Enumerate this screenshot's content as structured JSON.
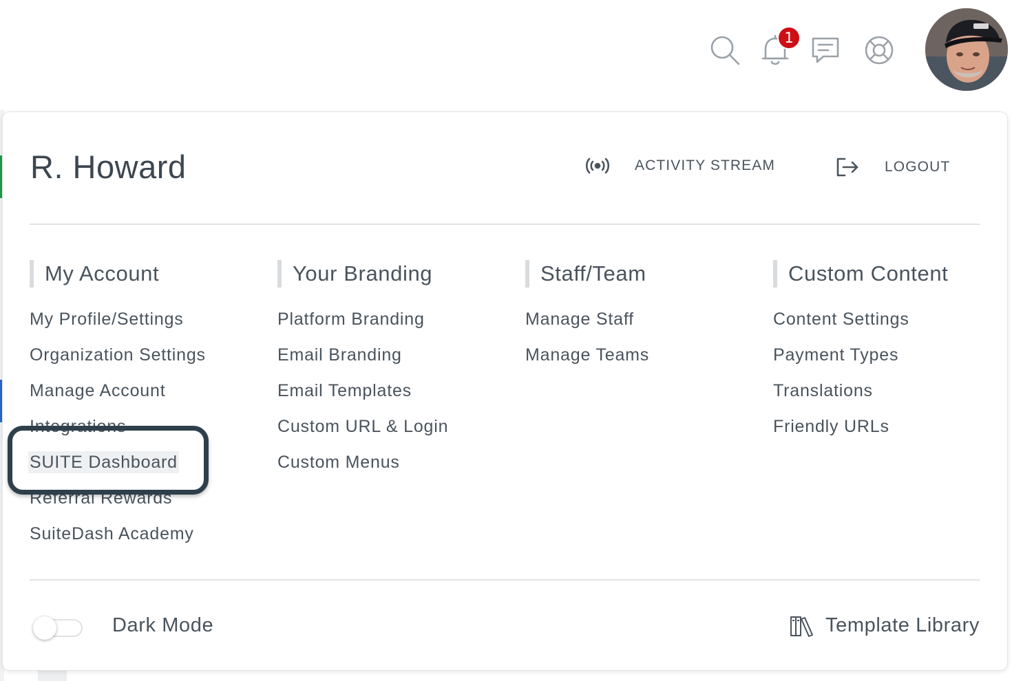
{
  "topbar": {
    "icons": [
      "search-icon",
      "bell-icon",
      "chat-icon",
      "support-icon"
    ],
    "notification_count": "1",
    "badge_color": "#cc1016"
  },
  "panel": {
    "user_name": "R. Howard",
    "activity_stream_label": "ACTIVITY STREAM",
    "logout_label": "LOGOUT",
    "columns": [
      {
        "title": "My Account",
        "items": [
          "My Profile/Settings",
          "Organization Settings",
          "Manage Account",
          "Integrations",
          "SUITE Dashboard",
          "Referral Rewards",
          "SuiteDash Academy"
        ]
      },
      {
        "title": "Your Branding",
        "items": [
          "Platform Branding",
          "Email Branding",
          "Email Templates",
          "Custom URL & Login",
          "Custom Menus"
        ]
      },
      {
        "title": "Staff/Team",
        "items": [
          "Manage Staff",
          "Manage Teams"
        ]
      },
      {
        "title": "Custom Content",
        "items": [
          "Content Settings",
          "Payment Types",
          "Translations",
          "Friendly URLs"
        ]
      }
    ],
    "dark_mode_label": "Dark Mode",
    "dark_mode_on": false,
    "template_library_label": "Template Library"
  },
  "colors": {
    "text": "#4a535c",
    "callout_border": "#2f3f4b",
    "accent_green": "#1f9a48",
    "accent_blue": "#2b68c8"
  }
}
